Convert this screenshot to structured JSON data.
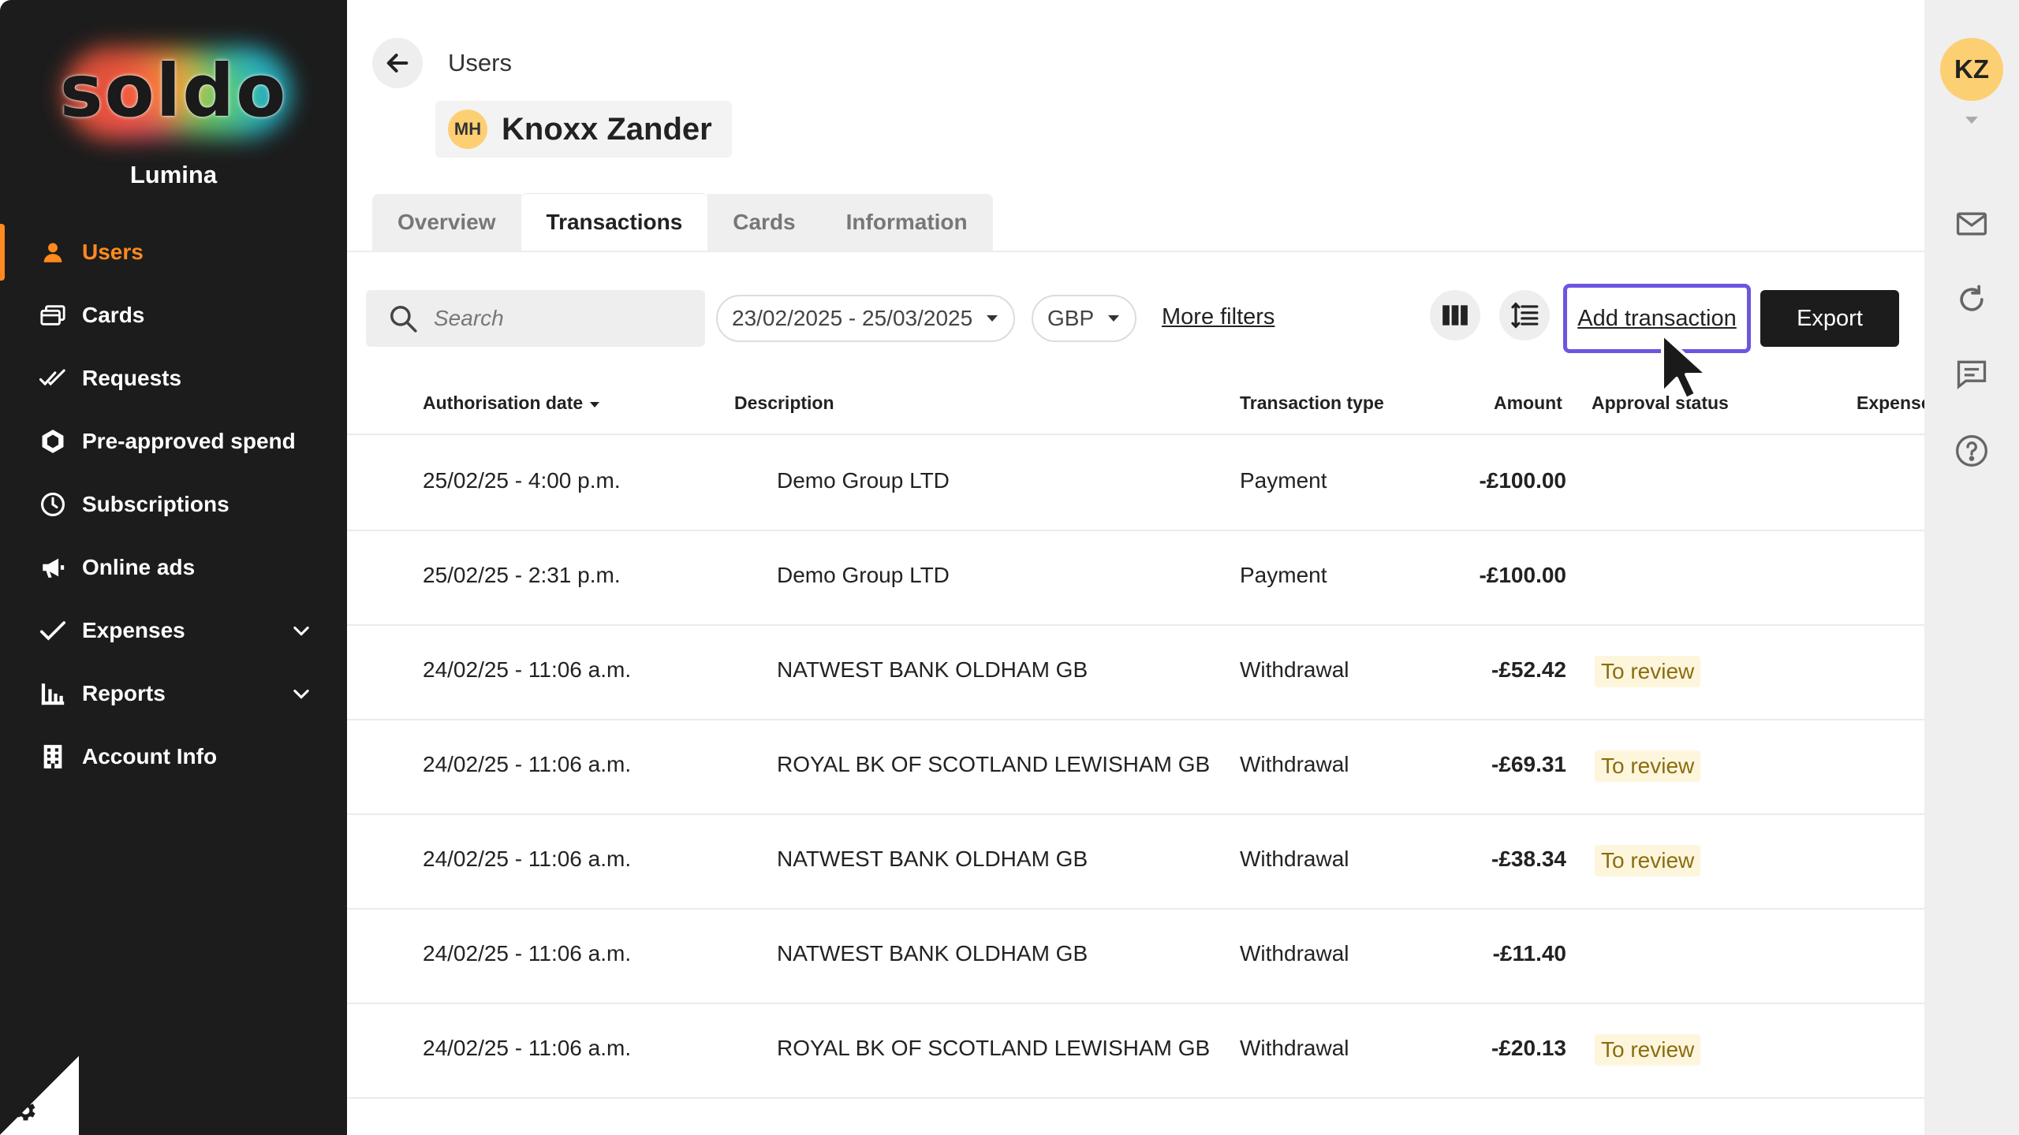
{
  "sidebar": {
    "logo_text": "soldo",
    "org_name": "Lumina",
    "items": [
      {
        "label": "Users",
        "icon": "user-icon",
        "active": true
      },
      {
        "label": "Cards",
        "icon": "cards-icon"
      },
      {
        "label": "Requests",
        "icon": "double-check-icon"
      },
      {
        "label": "Pre-approved spend",
        "icon": "hexagon-icon"
      },
      {
        "label": "Subscriptions",
        "icon": "clock-icon"
      },
      {
        "label": "Online ads",
        "icon": "megaphone-icon"
      },
      {
        "label": "Expenses",
        "icon": "checkmark-icon",
        "expandable": true
      },
      {
        "label": "Reports",
        "icon": "bar-chart-icon",
        "expandable": true
      },
      {
        "label": "Account Info",
        "icon": "building-icon"
      }
    ]
  },
  "rail": {
    "avatar_initials": "KZ",
    "icons": [
      "mail-icon",
      "refresh-icon",
      "chat-icon",
      "help-icon"
    ]
  },
  "header": {
    "breadcrumb": "Users",
    "user_initials": "MH",
    "user_name": "Knoxx Zander"
  },
  "tabs": [
    {
      "label": "Overview"
    },
    {
      "label": "Transactions",
      "active": true
    },
    {
      "label": "Cards"
    },
    {
      "label": "Information"
    }
  ],
  "toolbar": {
    "search_placeholder": "Search",
    "date_range": "23/02/2025 - 25/03/2025",
    "currency": "GBP",
    "more_filters": "More filters",
    "add_transaction": "Add transaction",
    "export": "Export"
  },
  "table": {
    "columns": [
      "Authorisation date",
      "Description",
      "Transaction type",
      "Amount",
      "Approval status",
      "Expense"
    ],
    "rows": [
      {
        "date": "25/02/25 - 4:00 p.m.",
        "description": "Demo Group LTD",
        "type": "Payment",
        "amount": "-£100.00",
        "status": ""
      },
      {
        "date": "25/02/25 - 2:31 p.m.",
        "description": "Demo Group LTD",
        "type": "Payment",
        "amount": "-£100.00",
        "status": ""
      },
      {
        "date": "24/02/25 - 11:06 a.m.",
        "description": "NATWEST BANK OLDHAM GB",
        "type": "Withdrawal",
        "amount": "-£52.42",
        "status": "To review"
      },
      {
        "date": "24/02/25 - 11:06 a.m.",
        "description": "ROYAL BK OF SCOTLAND LEWISHAM GB",
        "type": "Withdrawal",
        "amount": "-£69.31",
        "status": "To review"
      },
      {
        "date": "24/02/25 - 11:06 a.m.",
        "description": "NATWEST BANK OLDHAM GB",
        "type": "Withdrawal",
        "amount": "-£38.34",
        "status": "To review"
      },
      {
        "date": "24/02/25 - 11:06 a.m.",
        "description": "NATWEST BANK OLDHAM GB",
        "type": "Withdrawal",
        "amount": "-£11.40",
        "status": ""
      },
      {
        "date": "24/02/25 - 11:06 a.m.",
        "description": "ROYAL BK OF SCOTLAND LEWISHAM GB",
        "type": "Withdrawal",
        "amount": "-£20.13",
        "status": "To review"
      }
    ]
  },
  "colors": {
    "accent": "#ff8a1f",
    "sidebar_bg": "#1c1c1c",
    "focus_outline": "#6f54e0",
    "badge_bg": "#fdf6dc",
    "avatar_bg": "#fccf72"
  }
}
